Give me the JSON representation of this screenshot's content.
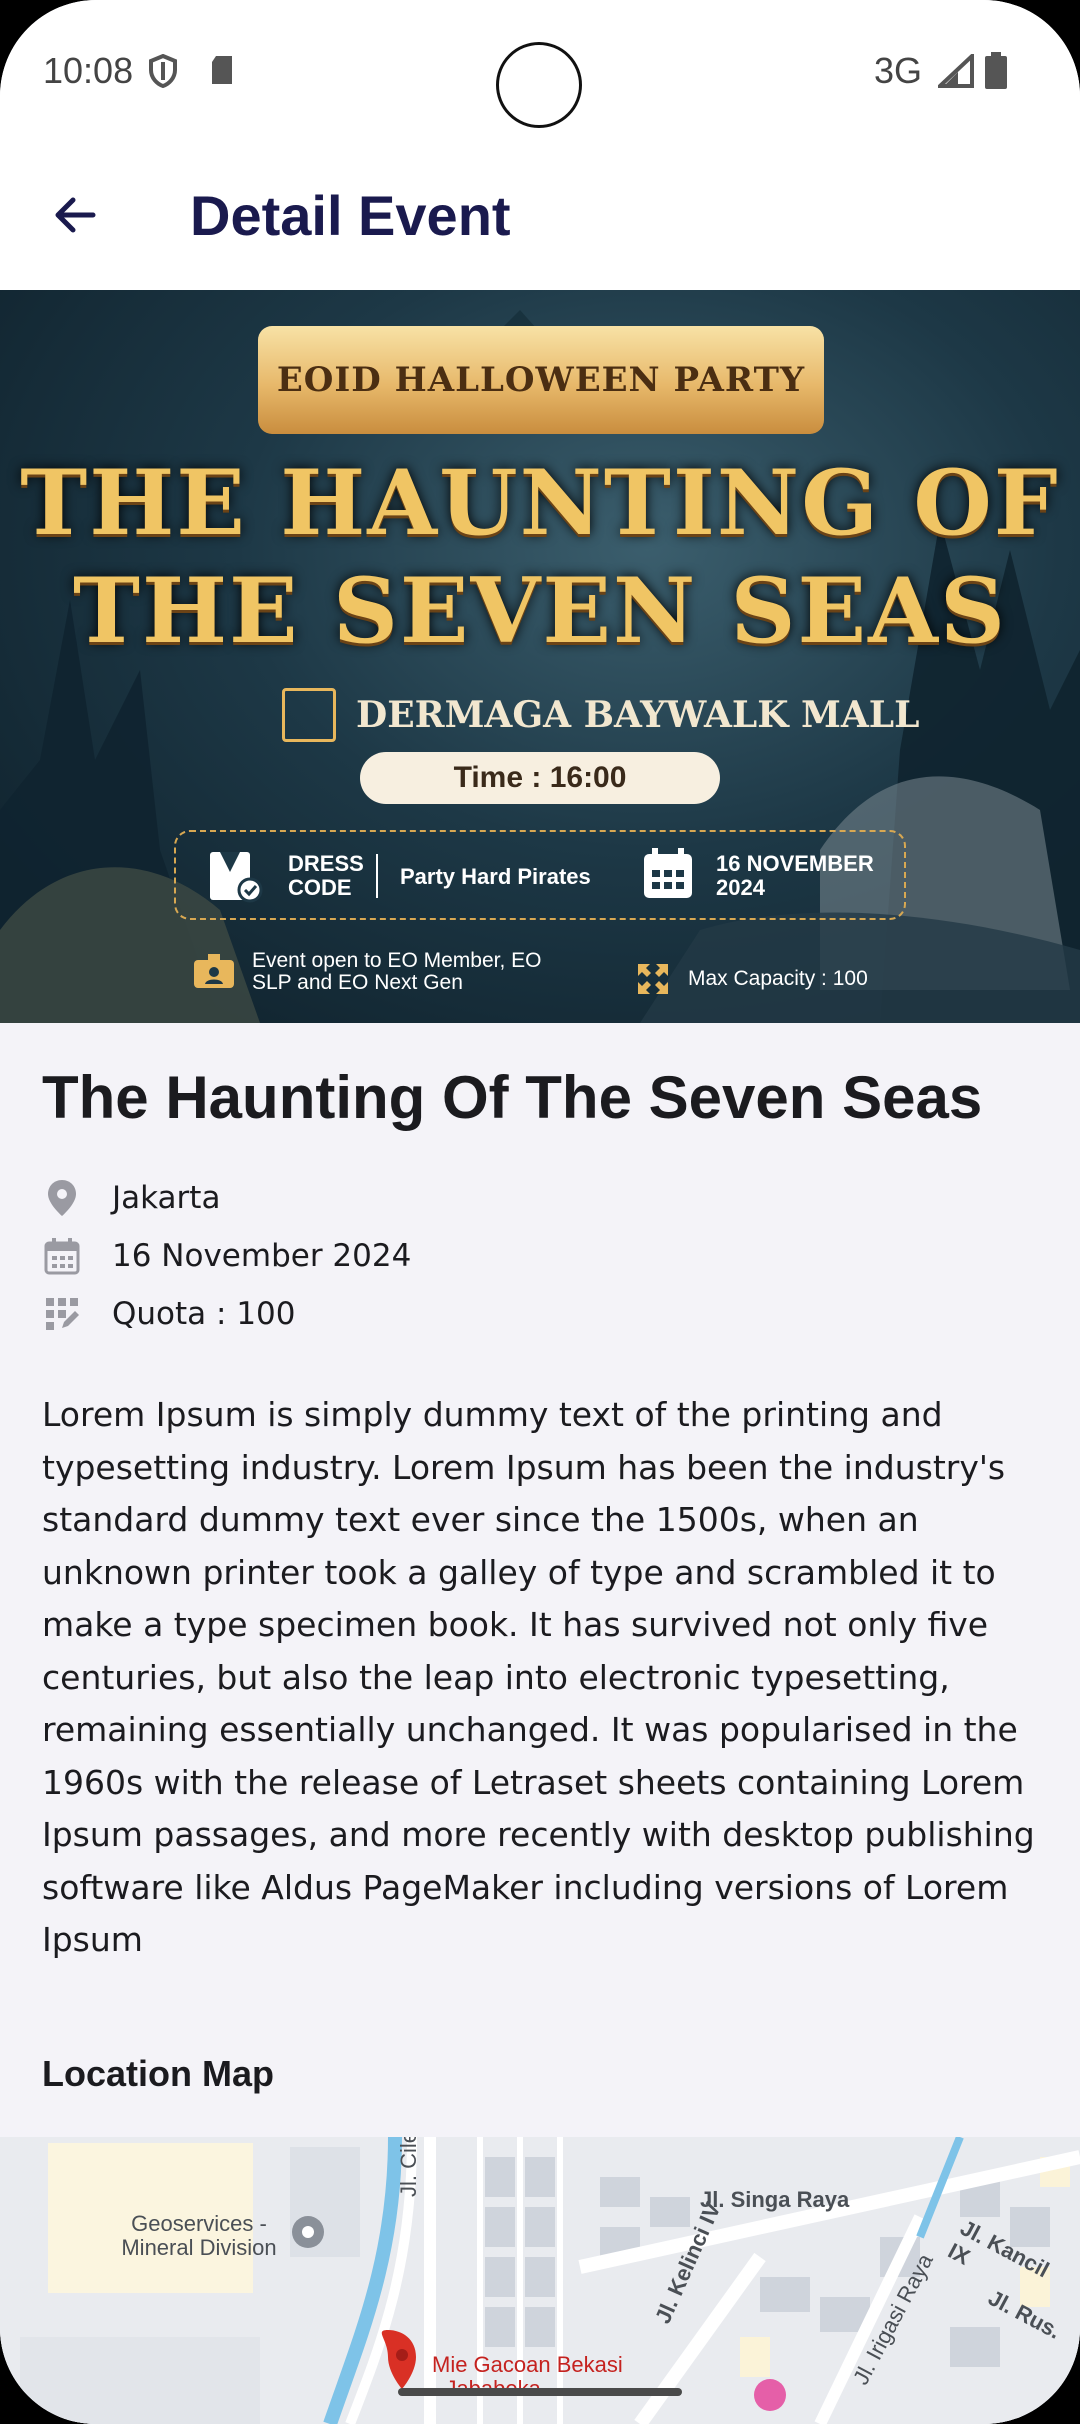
{
  "status_bar": {
    "time": "10:08",
    "network": "3G"
  },
  "app_bar": {
    "title": "Detail Event"
  },
  "banner": {
    "ribbon": "EOID HALLOWEEN PARTY",
    "headline_line1": "THE HAUNTING OF",
    "headline_line2": "THE SEVEN SEAS",
    "venue": "DERMAGA BAYWALK MALL",
    "time": "Time : 16:00",
    "dress_code_label": "DRESS CODE",
    "dress_code_value": "Party Hard Pirates",
    "date": "16 NOVEMBER 2024",
    "eligibility": "Event open to EO Member, EO SLP and EO Next Gen",
    "capacity": "Max Capacity : 100"
  },
  "event": {
    "title": "The Haunting Of The Seven Seas",
    "location": "Jakarta",
    "date": "16 November 2024",
    "quota": "Quota : 100",
    "description": "Lorem Ipsum is simply dummy text of the printing and typesetting industry. Lorem Ipsum has been the industry's standard dummy text ever since the 1500s, when an unknown printer took a galley of type and scrambled it to make a type specimen book. It has survived not only five centuries, but also the leap into electronic typesetting, remaining essentially unchanged. It was popularised in the 1960s with the release of Letraset sheets containing Lorem Ipsum passages, and more recently with desktop publishing software like Aldus PageMaker including versions of Lorem Ipsum"
  },
  "map_section": {
    "heading": "Location Map",
    "labels": {
      "geoservices": "Geoservices - Mineral Division",
      "cilemaha": "Jl. Cilemaha",
      "kelinci": "Jl. Kelinci IV",
      "singa_raya": "Jl. Singa Raya",
      "irigasi": "Jl. Irigasi Raya",
      "kancil": "Jl. Kancil IX",
      "rus": "Jl. Rus.",
      "place": "Mie Gacoan Bekasi - Jababeka"
    }
  },
  "colors": {
    "title": "#1a1a4e",
    "background": "#f4f3f8",
    "banner_gold": "#f0c564",
    "map_pin": "#d93025"
  },
  "icons": [
    "shield-icon",
    "sd-card-icon",
    "signal-icon",
    "battery-icon",
    "back-arrow-icon",
    "location-pin-icon",
    "calendar-icon",
    "quota-icon"
  ]
}
